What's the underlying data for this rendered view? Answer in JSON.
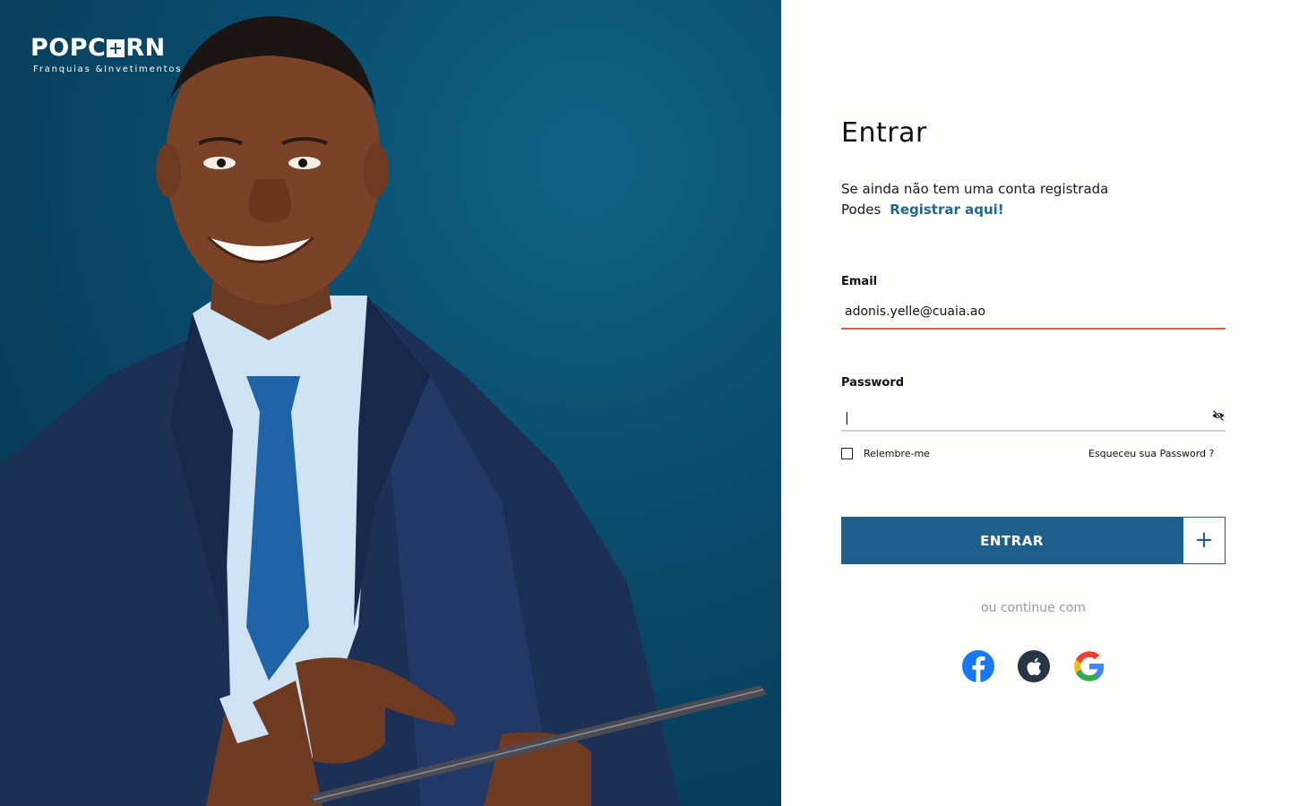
{
  "brand": {
    "name": "POPCORN",
    "name_part1": "POPC",
    "name_part2": "RN",
    "tagline": "Franquias &Invetimentos"
  },
  "login": {
    "title": "Entrar",
    "intro_line1": "Se ainda não tem uma conta registrada",
    "intro_line2": "Podes",
    "register_link": "Registrar aqui!",
    "email_label": "Email",
    "email_value": "adonis.yelle@cuaia.ao",
    "password_label": "Password",
    "password_value": "|",
    "remember_label": "Relembre-me",
    "forgot_label": "Esqueceu sua Password ?",
    "submit_label": "ENTRAR",
    "plus_label": "+",
    "continue_with": "ou continue com",
    "social": [
      "facebook-icon",
      "apple-icon",
      "google-icon"
    ]
  },
  "colors": {
    "primary": "#1f5f8b",
    "email_underline": "#e05a3c",
    "hero_bg": "#0a4c6d"
  }
}
